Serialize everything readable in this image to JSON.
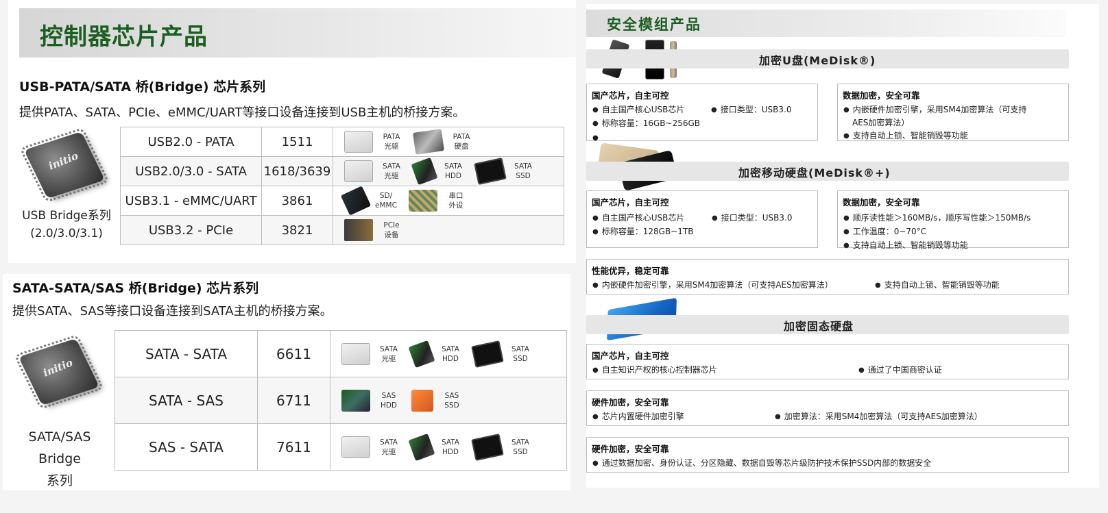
{
  "controller_section": {
    "title": "控制器芯片产品",
    "usb_series": {
      "title": "USB-PATA/SATA 桥(Bridge) 芯片系列",
      "description": "提供PATA、SATA、PCIe、eMMC/UART等接口设备连接到USB主机的桥接方案。",
      "chip_logo": "initio",
      "caption_line1": "USB Bridge系列",
      "caption_line2": "(2.0/3.0/3.1)",
      "rows": [
        {
          "interface": "USB2.0 - PATA",
          "model": "1511",
          "devices": [
            {
              "icon": "optical-drive-icon",
              "label": "PATA\n光驱"
            },
            {
              "icon": "hard-drive-icon",
              "label": "PATA\n硬盘"
            }
          ]
        },
        {
          "interface": "USB2.0/3.0 - SATA",
          "model": "1618/3639",
          "devices": [
            {
              "icon": "optical-drive-icon",
              "label": "SATA\n光驱"
            },
            {
              "icon": "hdd-icon",
              "label": "SATA\nHDD"
            },
            {
              "icon": "ssd-icon",
              "label": "SATA\nSSD"
            }
          ]
        },
        {
          "interface": "USB3.1 - eMMC/UART",
          "model": "3861",
          "devices": [
            {
              "icon": "emmc-chip-icon",
              "label": "SD/\neMMC"
            },
            {
              "icon": "circuit-board-icon",
              "label": "串口\n外设"
            }
          ]
        },
        {
          "interface": "USB3.2 - PCIe",
          "model": "3821",
          "devices": [
            {
              "icon": "pcie-device-icon",
              "label": "PCIe\n设备"
            }
          ]
        }
      ]
    },
    "sata_series": {
      "title": "SATA-SATA/SAS 桥(Bridge) 芯片系列",
      "description": "提供SATA、SAS等接口设备连接到SATA主机的桥接方案。",
      "chip_logo": "initio",
      "caption_line1": "SATA/SAS Bridge",
      "caption_line2": "系列",
      "rows": [
        {
          "interface": "SATA - SATA",
          "model": "6611",
          "devices": [
            {
              "icon": "optical-drive-icon",
              "label": "SATA\n光驱"
            },
            {
              "icon": "hdd-icon",
              "label": "SATA\nHDD"
            },
            {
              "icon": "ssd-icon",
              "label": "SATA\nSSD"
            }
          ]
        },
        {
          "interface": "SATA - SAS",
          "model": "6711",
          "devices": [
            {
              "icon": "sas-hdd-icon",
              "label": "SAS\nHDD"
            },
            {
              "icon": "sas-ssd-icon",
              "label": "SAS\nSSD"
            }
          ]
        },
        {
          "interface": "SAS - SATA",
          "model": "7611",
          "devices": [
            {
              "icon": "optical-drive-icon",
              "label": "SATA\n光驱"
            },
            {
              "icon": "hdd-icon",
              "label": "SATA\nHDD"
            },
            {
              "icon": "ssd-icon",
              "label": "SATA\nSSD"
            }
          ]
        }
      ]
    }
  },
  "security_section": {
    "title": "安全模组产品",
    "medisk": {
      "title": "加密U盘(MeDisk®)",
      "card1": {
        "title": "国产芯片，自主可控",
        "items": [
          "自主国产核心USB芯片",
          "接口类型：USB3.0",
          "标称容量：16GB~256GB"
        ]
      },
      "card2": {
        "title": "数据加密，安全可靠",
        "items": [
          "内嵌硬件加密引擎，采用SM4加密算法（可支持",
          "AES加密算法）",
          "支持自动上锁、智能销毁等功能"
        ]
      }
    },
    "medisk_plus": {
      "title": "加密移动硬盘(MeDisk®+)",
      "card1": {
        "title": "国产芯片，自主可控",
        "items": [
          "自主国产核心USB芯片",
          "接口类型：USB3.0",
          "标称容量：128GB~1TB"
        ]
      },
      "card2": {
        "title": "数据加密，安全可靠",
        "items": [
          "顺序读性能＞160MB/s，顺序写性能＞150MB/s",
          "工作温度：0~70°C",
          "支持自动上锁、智能销毁等功能"
        ]
      },
      "card3": {
        "title": "性能优异，稳定可靠",
        "items": [
          "内嵌硬件加密引擎，采用SM4加密算法（可支持AES加密算法）",
          "支持自动上锁、智能销毁等功能"
        ]
      }
    },
    "ssd": {
      "title": "加密固态硬盘",
      "card1": {
        "title": "国产芯片，自主可控",
        "items": [
          "自主知识产权的核心控制器芯片",
          "通过了中国商密认证"
        ]
      },
      "card2": {
        "title": "硬件加密，安全可靠",
        "items": [
          "芯片内置硬件加密引擎",
          "加密算法：采用SM4加密算法（可支持AES加密算法）"
        ]
      },
      "card3": {
        "title": "硬件加密，安全可靠",
        "items": [
          "通过数据加密、身份认证、分区隐藏、数据自毁等芯片级防护技术保护SSD内部的数据安全"
        ]
      }
    }
  },
  "colors": {
    "accent_green": "#1b5e20",
    "encrypted_ssd_blue": "#1565c0"
  }
}
